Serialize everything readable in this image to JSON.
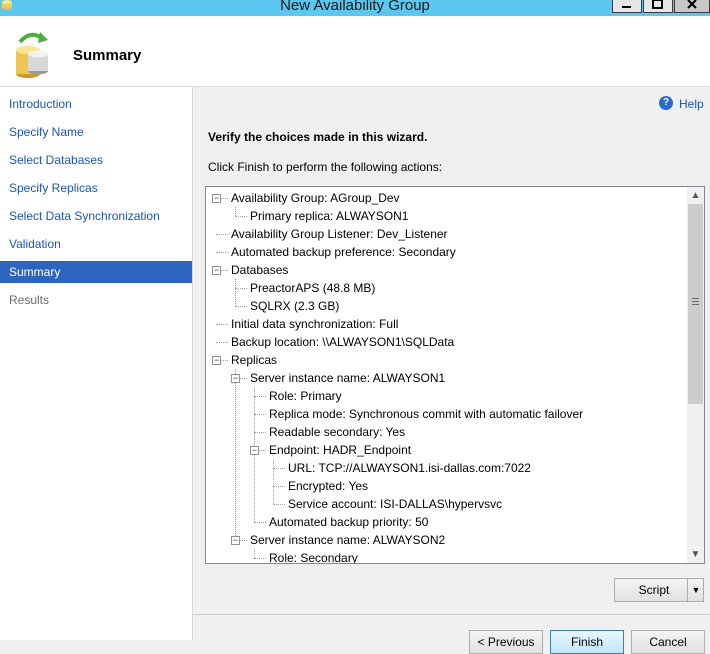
{
  "window": {
    "title": "New Availability Group"
  },
  "header": {
    "title": "Summary"
  },
  "nav": {
    "items": [
      {
        "label": "Introduction",
        "state": "link"
      },
      {
        "label": "Specify Name",
        "state": "link"
      },
      {
        "label": "Select Databases",
        "state": "link"
      },
      {
        "label": "Specify Replicas",
        "state": "link"
      },
      {
        "label": "Select Data Synchronization",
        "state": "link"
      },
      {
        "label": "Validation",
        "state": "link"
      },
      {
        "label": "Summary",
        "state": "active"
      },
      {
        "label": "Results",
        "state": "disabled"
      }
    ]
  },
  "help": {
    "label": "Help"
  },
  "content": {
    "heading": "Verify the choices made in this wizard.",
    "instructions": "Click Finish to perform the following actions:"
  },
  "tree": {
    "nodes": [
      {
        "level": 0,
        "text": "Availability Group: AGroup_Dev",
        "expander": "collapse"
      },
      {
        "level": 1,
        "text": "Primary replica: ALWAYSON1"
      },
      {
        "level": 0,
        "text": "Availability Group Listener: Dev_Listener"
      },
      {
        "level": 0,
        "text": "Automated backup preference: Secondary"
      },
      {
        "level": 0,
        "text": "Databases",
        "expander": "collapse"
      },
      {
        "level": 1,
        "text": "PreactorAPS (48.8 MB)"
      },
      {
        "level": 1,
        "text": "SQLRX (2.3 GB)"
      },
      {
        "level": 0,
        "text": "Initial data synchronization: Full"
      },
      {
        "level": 0,
        "text": "Backup location: \\\\ALWAYSON1\\SQLData"
      },
      {
        "level": 0,
        "text": "Replicas",
        "expander": "collapse"
      },
      {
        "level": 1,
        "text": "Server instance name: ALWAYSON1",
        "expander": "collapse"
      },
      {
        "level": 2,
        "text": "Role: Primary"
      },
      {
        "level": 2,
        "text": "Replica mode: Synchronous commit with automatic failover"
      },
      {
        "level": 2,
        "text": "Readable secondary: Yes"
      },
      {
        "level": 2,
        "text": "Endpoint: HADR_Endpoint",
        "expander": "collapse"
      },
      {
        "level": 3,
        "text": "URL: TCP://ALWAYSON1.isi-dallas.com:7022"
      },
      {
        "level": 3,
        "text": "Encrypted: Yes"
      },
      {
        "level": 3,
        "text": "Service account: ISI-DALLAS\\hypervsvc"
      },
      {
        "level": 2,
        "text": "Automated backup priority: 50"
      },
      {
        "level": 1,
        "text": "Server instance name: ALWAYSON2",
        "expander": "collapse"
      },
      {
        "level": 2,
        "text": "Role: Secondary"
      }
    ]
  },
  "buttons": {
    "script": "Script",
    "previous": "< Previous",
    "finish": "Finish",
    "cancel": "Cancel"
  },
  "colors": {
    "titlebar": "#5bc6ee",
    "nav_active": "#2c65c0",
    "link": "#1a55b8"
  }
}
